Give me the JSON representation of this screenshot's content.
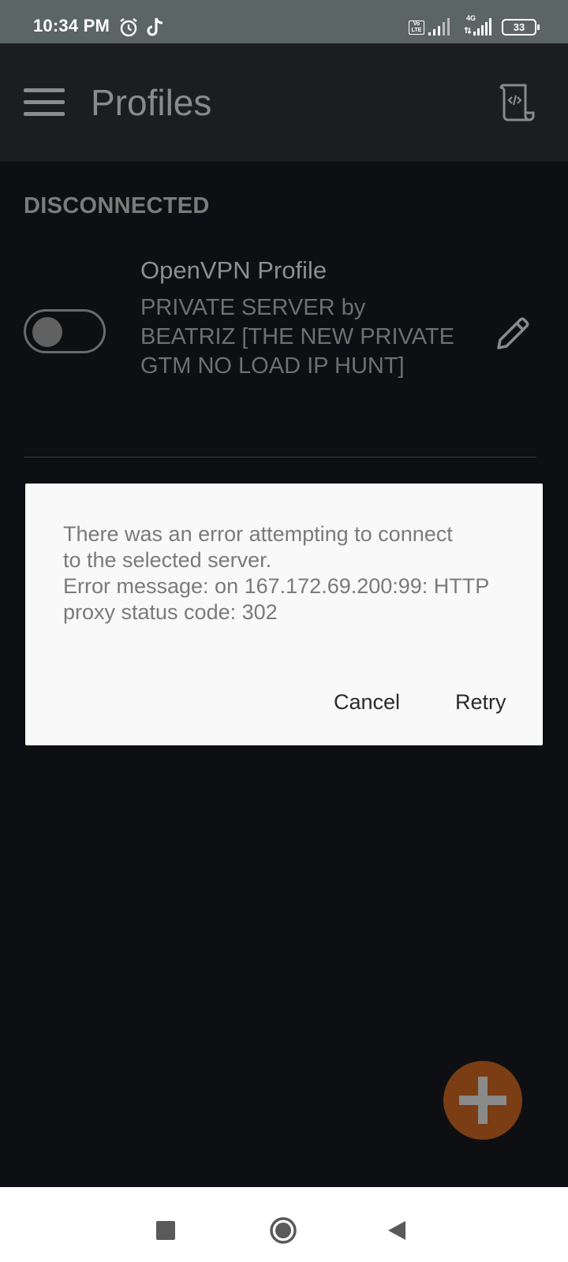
{
  "status_bar": {
    "time": "10:34 PM",
    "icons": [
      "alarm-icon",
      "tiktok-icon",
      "volte-icon",
      "signal-icon",
      "4g-signal-icon",
      "battery-icon"
    ],
    "network_label": "4G",
    "volte_label": "Vo LTE",
    "battery_level": "33"
  },
  "app_bar": {
    "title": "Profiles",
    "menu_icon": "hamburger-menu-icon",
    "log_icon": "log-scroll-icon"
  },
  "profiles": {
    "section_header": "DISCONNECTED",
    "items": [
      {
        "name": "OpenVPN Profile",
        "description": "PRIVATE SERVER by BEATRIZ [THE NEW PRIVATE GTM NO LOAD IP HUNT]",
        "toggle_on": false,
        "edit_icon": "pencil-icon"
      }
    ]
  },
  "dialog": {
    "line1": "There was an error attempting to connect",
    "line2": "to the selected server.",
    "line3": "Error message: on 167.172.69.200:99: HTTP",
    "line4": "proxy status code: 302",
    "cancel_label": "Cancel",
    "retry_label": "Retry"
  },
  "fab": {
    "icon": "plus-icon"
  },
  "nav_bar": {
    "icons": [
      "recent-apps-icon",
      "home-icon",
      "back-icon"
    ]
  },
  "colors": {
    "accent": "#7a3d14",
    "background": "#0d0f12",
    "app_bar": "#1b1d1f",
    "status_bar": "#5b6566",
    "dialog": "#f9f9f9"
  }
}
